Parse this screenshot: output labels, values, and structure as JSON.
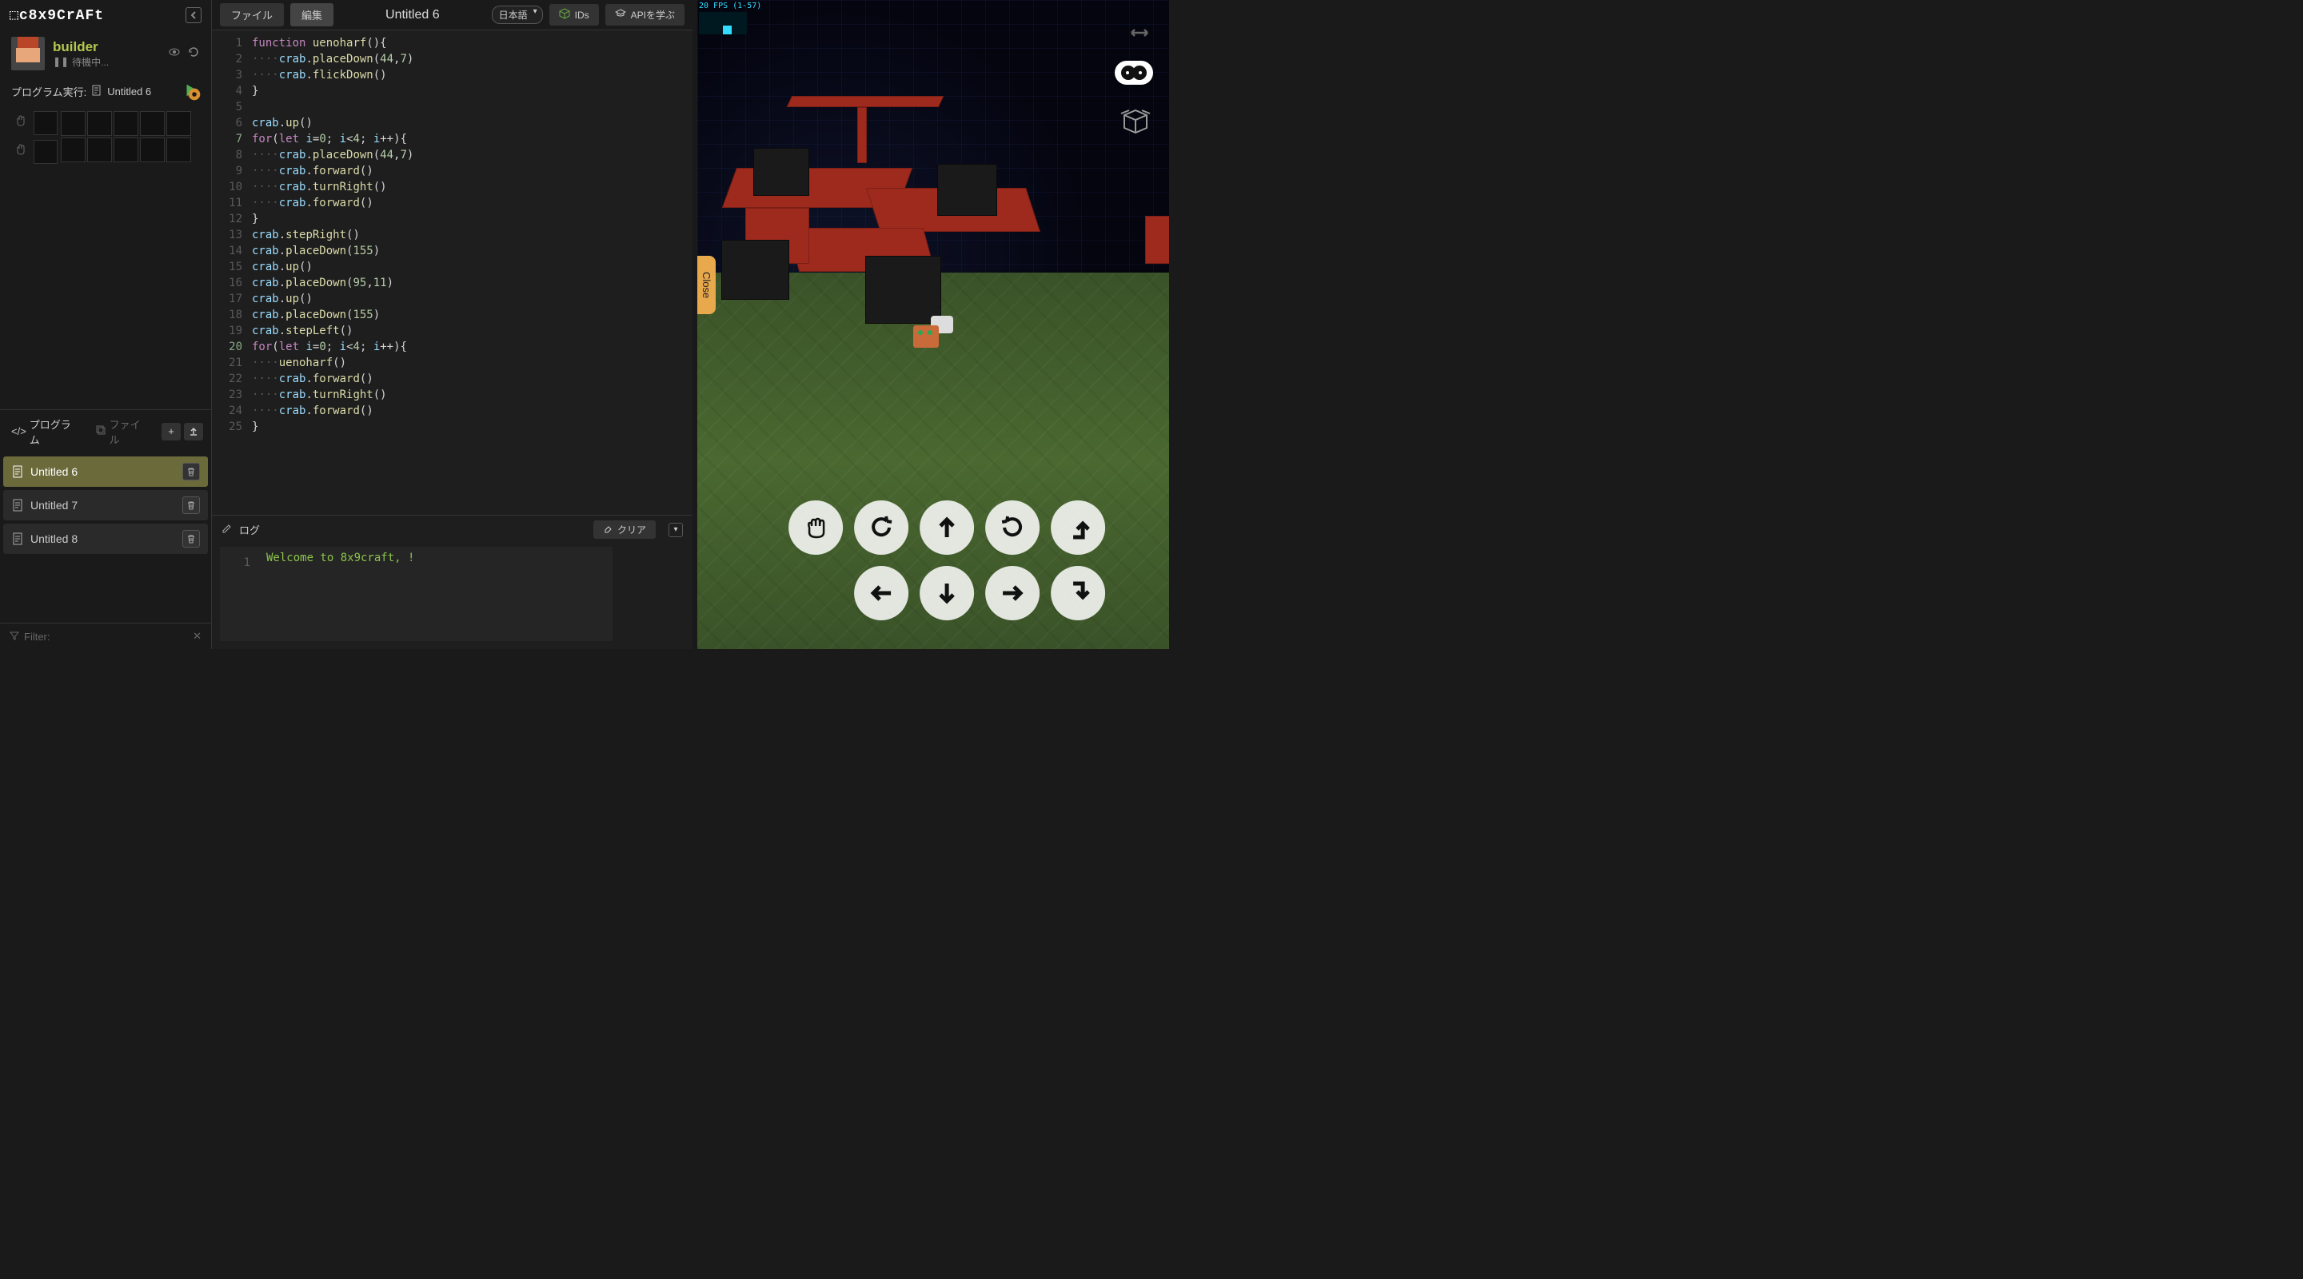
{
  "app": {
    "logo": "⬚c8x9CrAFt"
  },
  "builder": {
    "name": "builder",
    "status_icon": "pause-icon",
    "status": "待機中..."
  },
  "exec": {
    "label": "プログラム実行:",
    "current": "Untitled 6"
  },
  "tabs": {
    "programs": "プログラム",
    "files": "ファイル"
  },
  "files": [
    {
      "name": "Untitled 6",
      "active": true
    },
    {
      "name": "Untitled 7",
      "active": false
    },
    {
      "name": "Untitled 8",
      "active": false
    }
  ],
  "filter": {
    "label": "Filter:"
  },
  "menu": {
    "file": "ファイル",
    "edit": "編集",
    "title": "Untitled 6",
    "lang": "日本語",
    "ids": "IDs",
    "learn_api": "APIを学ぶ"
  },
  "code": {
    "lines": [
      [
        [
          "kw",
          "function"
        ],
        [
          "pn",
          " "
        ],
        [
          "fn",
          "uenoharf"
        ],
        [
          "pn",
          "(){"
        ]
      ],
      [
        [
          "dot",
          "····"
        ],
        [
          "id",
          "crab"
        ],
        [
          "pn",
          "."
        ],
        [
          "fn",
          "placeDown"
        ],
        [
          "pn",
          "("
        ],
        [
          "num",
          "44"
        ],
        [
          "pn",
          ","
        ],
        [
          "num",
          "7"
        ],
        [
          "pn",
          ")"
        ]
      ],
      [
        [
          "dot",
          "····"
        ],
        [
          "id",
          "crab"
        ],
        [
          "pn",
          "."
        ],
        [
          "fn",
          "flickDown"
        ],
        [
          "pn",
          "()"
        ]
      ],
      [
        [
          "pn",
          "}"
        ]
      ],
      [],
      [
        [
          "id",
          "crab"
        ],
        [
          "pn",
          "."
        ],
        [
          "fn",
          "up"
        ],
        [
          "pn",
          "()"
        ]
      ],
      [
        [
          "kw",
          "for"
        ],
        [
          "pn",
          "("
        ],
        [
          "kw",
          "let"
        ],
        [
          "pn",
          " "
        ],
        [
          "id",
          "i"
        ],
        [
          "pn",
          "="
        ],
        [
          "num",
          "0"
        ],
        [
          "pn",
          "; "
        ],
        [
          "id",
          "i"
        ],
        [
          "pn",
          "<"
        ],
        [
          "num",
          "4"
        ],
        [
          "pn",
          "; "
        ],
        [
          "id",
          "i"
        ],
        [
          "pn",
          "++){"
        ]
      ],
      [
        [
          "dot",
          "····"
        ],
        [
          "id",
          "crab"
        ],
        [
          "pn",
          "."
        ],
        [
          "fn",
          "placeDown"
        ],
        [
          "pn",
          "("
        ],
        [
          "num",
          "44"
        ],
        [
          "pn",
          ","
        ],
        [
          "num",
          "7"
        ],
        [
          "pn",
          ")"
        ]
      ],
      [
        [
          "dot",
          "····"
        ],
        [
          "id",
          "crab"
        ],
        [
          "pn",
          "."
        ],
        [
          "fn",
          "forward"
        ],
        [
          "pn",
          "()"
        ]
      ],
      [
        [
          "dot",
          "····"
        ],
        [
          "id",
          "crab"
        ],
        [
          "pn",
          "."
        ],
        [
          "fn",
          "turnRight"
        ],
        [
          "pn",
          "()"
        ]
      ],
      [
        [
          "dot",
          "····"
        ],
        [
          "id",
          "crab"
        ],
        [
          "pn",
          "."
        ],
        [
          "fn",
          "forward"
        ],
        [
          "pn",
          "()"
        ]
      ],
      [
        [
          "pn",
          "}"
        ]
      ],
      [
        [
          "id",
          "crab"
        ],
        [
          "pn",
          "."
        ],
        [
          "fn",
          "stepRight"
        ],
        [
          "pn",
          "()"
        ]
      ],
      [
        [
          "id",
          "crab"
        ],
        [
          "pn",
          "."
        ],
        [
          "fn",
          "placeDown"
        ],
        [
          "pn",
          "("
        ],
        [
          "num",
          "155"
        ],
        [
          "pn",
          ")"
        ]
      ],
      [
        [
          "id",
          "crab"
        ],
        [
          "pn",
          "."
        ],
        [
          "fn",
          "up"
        ],
        [
          "pn",
          "()"
        ]
      ],
      [
        [
          "id",
          "crab"
        ],
        [
          "pn",
          "."
        ],
        [
          "fn",
          "placeDown"
        ],
        [
          "pn",
          "("
        ],
        [
          "num",
          "95"
        ],
        [
          "pn",
          ","
        ],
        [
          "num",
          "11"
        ],
        [
          "pn",
          ")"
        ]
      ],
      [
        [
          "id",
          "crab"
        ],
        [
          "pn",
          "."
        ],
        [
          "fn",
          "up"
        ],
        [
          "pn",
          "()"
        ]
      ],
      [
        [
          "id",
          "crab"
        ],
        [
          "pn",
          "."
        ],
        [
          "fn",
          "placeDown"
        ],
        [
          "pn",
          "("
        ],
        [
          "num",
          "155"
        ],
        [
          "pn",
          ")"
        ]
      ],
      [
        [
          "id",
          "crab"
        ],
        [
          "pn",
          "."
        ],
        [
          "fn",
          "stepLeft"
        ],
        [
          "pn",
          "()"
        ]
      ],
      [
        [
          "kw",
          "for"
        ],
        [
          "pn",
          "("
        ],
        [
          "kw",
          "let"
        ],
        [
          "pn",
          " "
        ],
        [
          "id",
          "i"
        ],
        [
          "pn",
          "="
        ],
        [
          "num",
          "0"
        ],
        [
          "pn",
          "; "
        ],
        [
          "id",
          "i"
        ],
        [
          "pn",
          "<"
        ],
        [
          "num",
          "4"
        ],
        [
          "pn",
          "; "
        ],
        [
          "id",
          "i"
        ],
        [
          "pn",
          "++){"
        ]
      ],
      [
        [
          "dot",
          "····"
        ],
        [
          "fn",
          "uenoharf"
        ],
        [
          "pn",
          "()"
        ]
      ],
      [
        [
          "dot",
          "····"
        ],
        [
          "id",
          "crab"
        ],
        [
          "pn",
          "."
        ],
        [
          "fn",
          "forward"
        ],
        [
          "pn",
          "()"
        ]
      ],
      [
        [
          "dot",
          "····"
        ],
        [
          "id",
          "crab"
        ],
        [
          "pn",
          "."
        ],
        [
          "fn",
          "turnRight"
        ],
        [
          "pn",
          "()"
        ]
      ],
      [
        [
          "dot",
          "····"
        ],
        [
          "id",
          "crab"
        ],
        [
          "pn",
          "."
        ],
        [
          "fn",
          "forward"
        ],
        [
          "pn",
          "()"
        ]
      ],
      [
        [
          "pn",
          "}"
        ]
      ]
    ],
    "highlight": [
      7,
      20
    ]
  },
  "log": {
    "title": "ログ",
    "clear": "クリア",
    "messages": [
      "Welcome to 8x9craft, !"
    ]
  },
  "viewport": {
    "fps_text": "20 FPS (1-57)",
    "close": "Close"
  }
}
